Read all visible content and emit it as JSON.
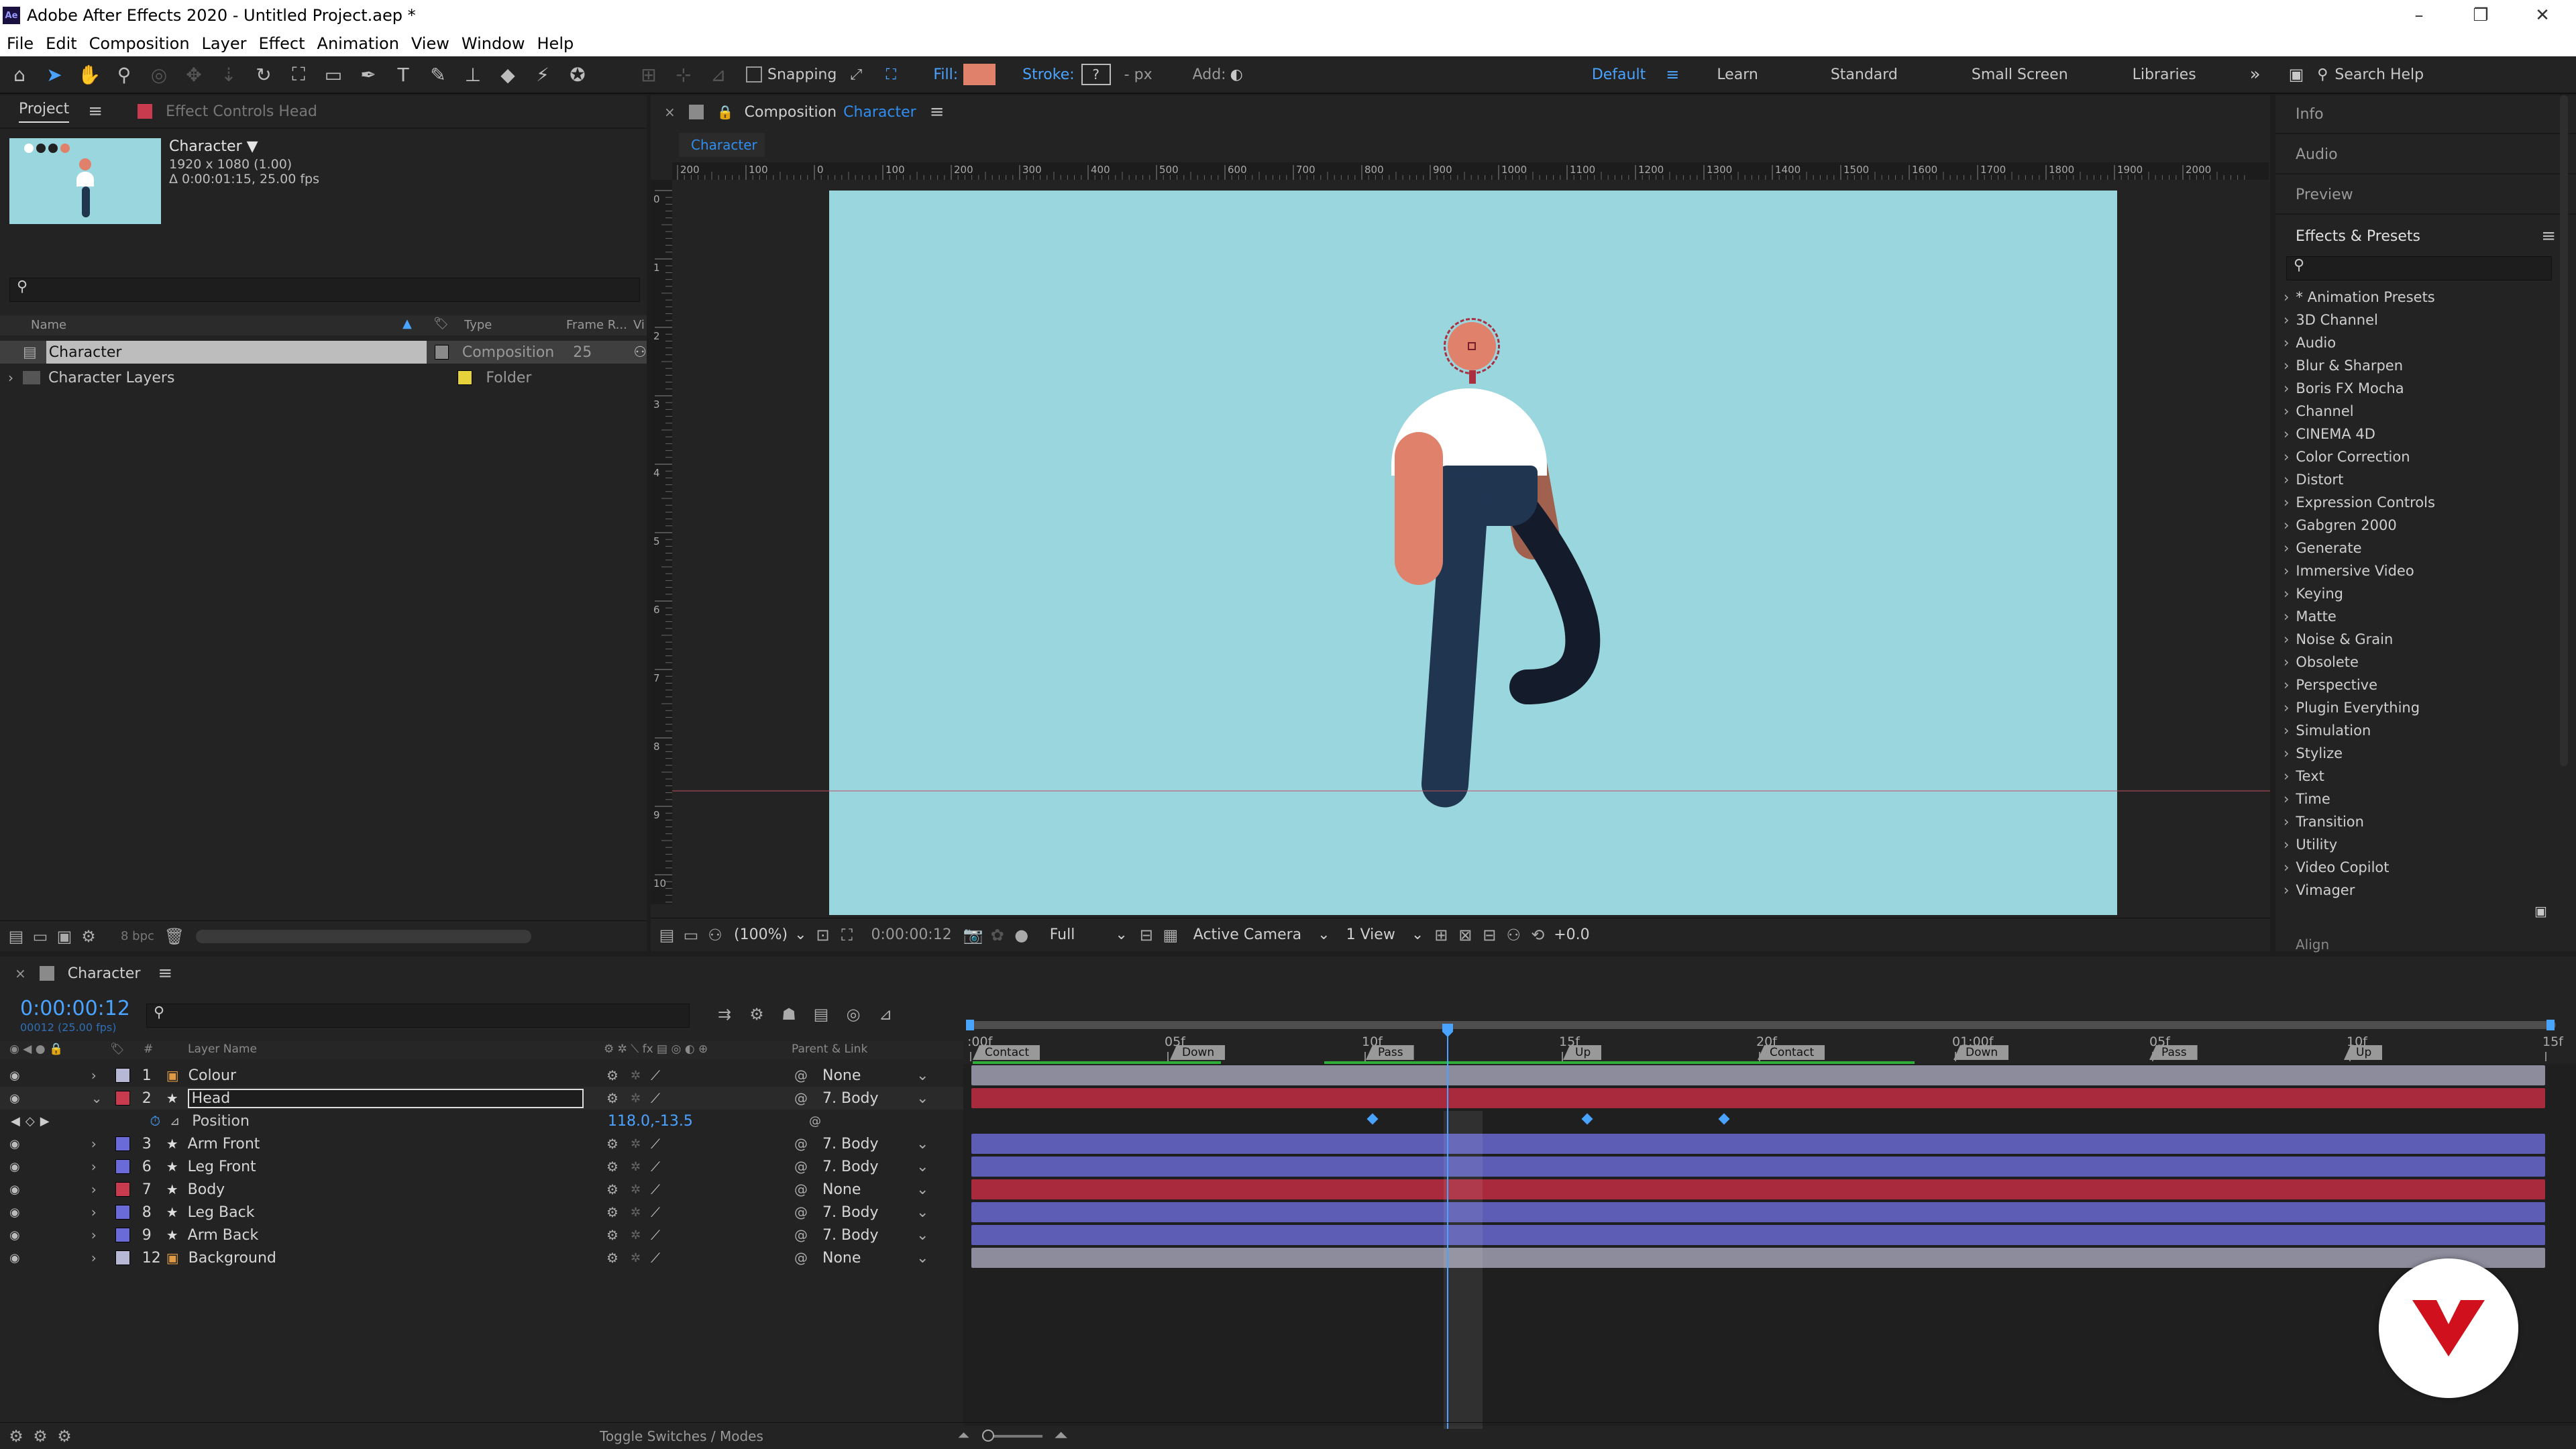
{
  "app": {
    "title": "Adobe After Effects 2020 - Untitled Project.aep *",
    "icon_label": "Ae",
    "window_controls": [
      "–",
      "❐",
      "✕"
    ]
  },
  "menu": [
    "File",
    "Edit",
    "Composition",
    "Layer",
    "Effect",
    "Animation",
    "View",
    "Window",
    "Help"
  ],
  "toolbar": {
    "snapping": "Snapping",
    "fill": "Fill:",
    "stroke": "Stroke:",
    "stroke_value": "?",
    "px": "- px",
    "add": "Add:",
    "workspaces": [
      "Default",
      "Learn",
      "Standard",
      "Small Screen",
      "Libraries"
    ],
    "more": "»",
    "search": "Search Help"
  },
  "project_panel": {
    "tab": "Project",
    "effect_controls": "Effect Controls Head",
    "thumb_name": "Character ▼",
    "thumb_res": "1920 x 1080 (1.00)",
    "thumb_dur": "Δ 0:00:01:15, 25.00 fps",
    "search_placeholder": "",
    "columns": [
      "Name",
      "Type",
      "Frame R...",
      "Vi"
    ],
    "items": [
      {
        "name": "Character",
        "type": "Composition",
        "fps": "25",
        "color": "#8a8a8a"
      },
      {
        "name": "Character Layers",
        "type": "Folder",
        "fps": "",
        "color": "#e6d23a"
      }
    ],
    "bpc": "8 bpc"
  },
  "composition": {
    "tab_prefix": "Composition",
    "tab_name": "Character",
    "flow_tab": "Character",
    "ruler_labels": [
      "200",
      "100",
      "0",
      "100",
      "200",
      "300",
      "400",
      "500",
      "600",
      "700",
      "800",
      "900",
      "1000",
      "1100",
      "1200",
      "1300",
      "1400",
      "1500",
      "1600",
      "1700",
      "1800",
      "1900",
      "2000"
    ],
    "vruler_labels": [
      "0",
      "1",
      "2",
      "3",
      "4",
      "5",
      "6",
      "7",
      "8",
      "9",
      "10"
    ],
    "bottom": {
      "zoom": "(100%)",
      "time": "0:00:00:12",
      "quality": "Full",
      "camera": "Active Camera",
      "views": "1 View",
      "exposure": "+0.0"
    },
    "colors": {
      "background": "#9ad6de",
      "skin": "#e0826b",
      "shirt": "#ffffff",
      "pants": "#1f3550",
      "arm_back": "#a1614f",
      "leg_back": "#141c2b"
    }
  },
  "right_panel": {
    "sections": [
      "Info",
      "Audio",
      "Preview"
    ],
    "effects_title": "Effects & Presets",
    "effects": [
      "* Animation Presets",
      "3D Channel",
      "Audio",
      "Blur & Sharpen",
      "Boris FX Mocha",
      "Channel",
      "CINEMA 4D",
      "Color Correction",
      "Distort",
      "Expression Controls",
      "Gabgren 2000",
      "Generate",
      "Immersive Video",
      "Keying",
      "Matte",
      "Noise & Grain",
      "Obsolete",
      "Perspective",
      "Plugin Everything",
      "Simulation",
      "Stylize",
      "Text",
      "Time",
      "Transition",
      "Utility",
      "Video Copilot",
      "Vimager"
    ],
    "align": "Align"
  },
  "timeline": {
    "tab": "Character",
    "timecode": "0:00:00:12",
    "timecode_sub": "00012 (25.00 fps)",
    "layer_header": "Layer Name",
    "parent_header": "Parent & Link",
    "ruler": [
      ":00f",
      "05f",
      "10f",
      "15f",
      "20f",
      "01:00f",
      "05f",
      "10f",
      "15f"
    ],
    "markers": [
      "Contact",
      "Down",
      "Pass",
      "Up",
      "Contact",
      "Down",
      "Pass",
      "Up"
    ],
    "layers": [
      {
        "num": "1",
        "name": "Colour",
        "label": "#b7b7d6",
        "parent": "None",
        "icon": "comp"
      },
      {
        "num": "2",
        "name": "Head",
        "label": "#c83a4d",
        "parent": "7. Body",
        "icon": "star"
      },
      {
        "num": "3",
        "name": "Arm Front",
        "label": "#6a6ad8",
        "parent": "7. Body",
        "icon": "star"
      },
      {
        "num": "6",
        "name": "Leg Front",
        "label": "#6a6ad8",
        "parent": "7. Body",
        "icon": "star"
      },
      {
        "num": "7",
        "name": "Body",
        "label": "#c83a4d",
        "parent": "None",
        "icon": "star"
      },
      {
        "num": "8",
        "name": "Leg Back",
        "label": "#6a6ad8",
        "parent": "7. Body",
        "icon": "star"
      },
      {
        "num": "9",
        "name": "Arm Back",
        "label": "#6a6ad8",
        "parent": "7. Body",
        "icon": "star"
      },
      {
        "num": "12",
        "name": "Background",
        "label": "#b7b7d6",
        "parent": "None",
        "icon": "comp"
      }
    ],
    "position_label": "Position",
    "position_value": "118.0,-13.5",
    "toggle_label": "Toggle Switches / Modes"
  }
}
